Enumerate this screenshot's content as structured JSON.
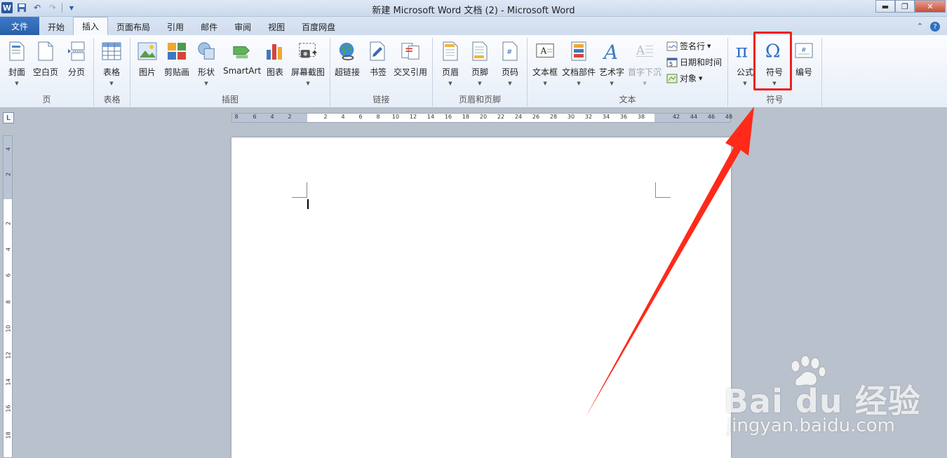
{
  "title_bar": {
    "document_title": "新建 Microsoft Word 文档 (2)  -  Microsoft Word",
    "app_icon": "W",
    "qat_items": [
      "word-icon",
      "save-icon",
      "undo-icon",
      "redo-icon",
      "customize-icon"
    ]
  },
  "tabs": [
    {
      "label": "文件",
      "kind": "file"
    },
    {
      "label": "开始"
    },
    {
      "label": "插入",
      "active": true
    },
    {
      "label": "页面布局"
    },
    {
      "label": "引用"
    },
    {
      "label": "邮件"
    },
    {
      "label": "审阅"
    },
    {
      "label": "视图"
    },
    {
      "label": "百度网盘"
    }
  ],
  "ribbon": {
    "groups": {
      "pages": {
        "label": "页",
        "buttons": [
          "封面",
          "空白页",
          "分页"
        ]
      },
      "tables": {
        "label": "表格",
        "buttons": [
          "表格"
        ]
      },
      "illustrations": {
        "label": "插图",
        "buttons": [
          "图片",
          "剪贴画",
          "形状",
          "SmartArt",
          "图表",
          "屏幕截图"
        ]
      },
      "links": {
        "label": "链接",
        "buttons": [
          "超链接",
          "书签",
          "交叉引用"
        ]
      },
      "header_footer": {
        "label": "页眉和页脚",
        "buttons": [
          "页眉",
          "页脚",
          "页码"
        ]
      },
      "text": {
        "label": "文本",
        "buttons": [
          "文本框",
          "文档部件",
          "艺术字",
          "首字下沉"
        ],
        "small_buttons": [
          "签名行",
          "日期和时间",
          "对象"
        ]
      },
      "symbols": {
        "label": "符号",
        "buttons": [
          "公式",
          "符号",
          "编号"
        ]
      }
    }
  },
  "ruler": {
    "h_numbers": [
      "8",
      "6",
      "4",
      "2",
      "2",
      "4",
      "6",
      "8",
      "10",
      "12",
      "14",
      "16",
      "18",
      "20",
      "22",
      "24",
      "26",
      "28",
      "30",
      "32",
      "34",
      "36",
      "38",
      "42",
      "44",
      "46",
      "48"
    ],
    "v_numbers": [
      "4",
      "2",
      "2",
      "4",
      "6",
      "8",
      "10",
      "12",
      "14",
      "16",
      "18"
    ]
  },
  "watermark": {
    "brand": "Bai du 经验",
    "site": "jingyan.baidu.com"
  },
  "colors": {
    "highlight": "#ee2020",
    "arrow": "#ff2a1a",
    "file_tab": "#2a5fa8"
  }
}
